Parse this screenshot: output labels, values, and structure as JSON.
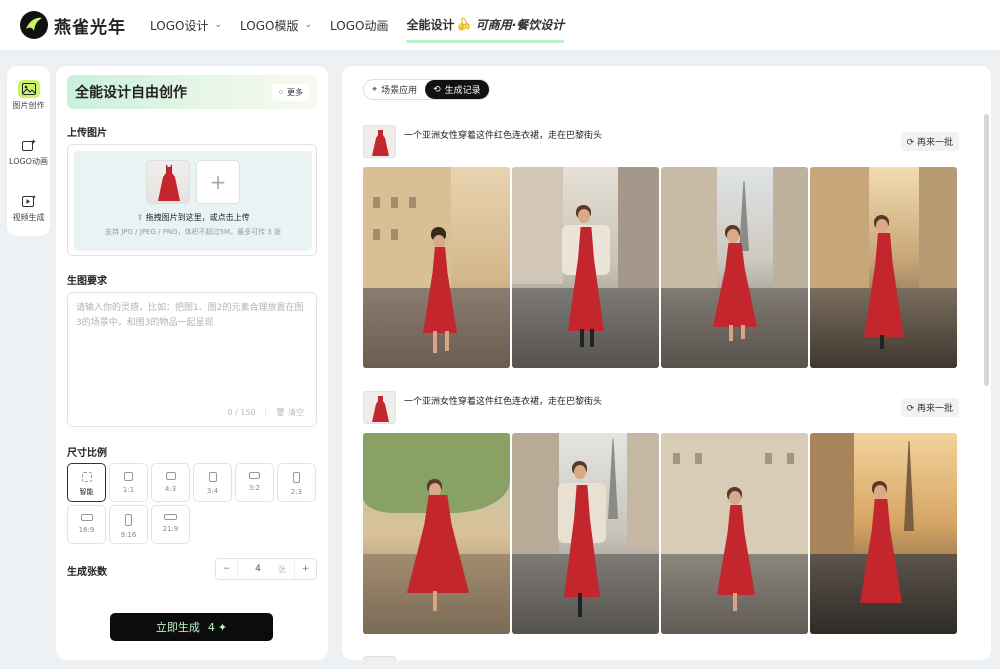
{
  "brand": {
    "name": "燕雀光年"
  },
  "nav": {
    "items": [
      {
        "label": "LOGO设计",
        "has_dropdown": true
      },
      {
        "label": "LOGO模版",
        "has_dropdown": true
      },
      {
        "label": "LOGO动画",
        "has_dropdown": false
      }
    ],
    "active": {
      "label": "全能设计",
      "promo": "可商用·餐饮设计"
    }
  },
  "rail": {
    "items": [
      {
        "label": "图片创作",
        "icon": "image-icon",
        "active": true
      },
      {
        "label": "LOGO动画",
        "icon": "sparkle-icon",
        "active": false
      },
      {
        "label": "视频生成",
        "icon": "video-icon",
        "active": false
      }
    ]
  },
  "panel": {
    "title": "全能设计自由创作",
    "more_label": "更多",
    "upload": {
      "section_label": "上传图片",
      "hint": "拖拽图片到这里，或点击上传",
      "sub": "支持 JPG / JPEG / PNG，体积不超过5M，最多可传 3 张"
    },
    "prompt": {
      "section_label": "生图要求",
      "placeholder": "请输入你的灵感，比如：把图1、图2的元素合理放置在图3的场景中，和图3的物品一起呈现",
      "counter": "0 / 150",
      "clear_label": "清空"
    },
    "ratio": {
      "section_label": "尺寸比例",
      "options": [
        "智能",
        "1:1",
        "4:3",
        "3:4",
        "3:2",
        "2:3",
        "16:9",
        "9:16",
        "21:9"
      ],
      "selected": "智能"
    },
    "count": {
      "label": "生成张数",
      "value": "4",
      "unit": "张"
    },
    "generate": {
      "label": "立即生成",
      "cost": "4"
    }
  },
  "main": {
    "tabs": [
      {
        "label": "场景应用",
        "icon": "location-icon",
        "active": false
      },
      {
        "label": "生成记录",
        "icon": "history-icon",
        "active": true
      }
    ],
    "batches": [
      {
        "prompt": "一个亚洲女性穿着这件红色连衣裙，走在巴黎街头",
        "retry_label": "再来一批",
        "image_count": 4
      },
      {
        "prompt": "一个亚洲女性穿着这件红色连衣裙，走在巴黎街头",
        "retry_label": "再来一批",
        "image_count": 4
      }
    ]
  },
  "colors": {
    "accent_green": "#c8f36a",
    "dress_red": "#c3262c",
    "button_dark": "#0c0c0c"
  }
}
